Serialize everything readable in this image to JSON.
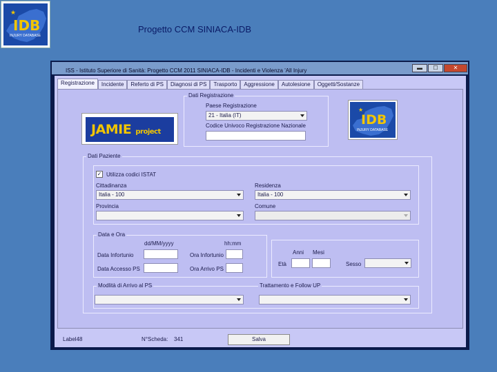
{
  "slide": {
    "title": "Progetto CCM SINIACA-IDB",
    "logo": {
      "main": "IDB",
      "tag": "INJURY DATABASE"
    }
  },
  "window": {
    "title": "ISS - Istituto Superiore di Sanità: Progetto CCM 2011 SINIACA-IDB - Incidenti e Violenza 'All Injury",
    "buttons": {
      "minimize": "▬",
      "maximize": "☐",
      "close": "✕"
    }
  },
  "tabs": [
    {
      "label": "Registrazione"
    },
    {
      "label": "Incidente"
    },
    {
      "label": "Referto di PS"
    },
    {
      "label": "Diagnosi di PS"
    },
    {
      "label": "Trasporto"
    },
    {
      "label": "Aggressione"
    },
    {
      "label": "Autolesione"
    },
    {
      "label": "Oggetti/Sostanze"
    }
  ],
  "logos": {
    "jamie": {
      "main": "JAMIE",
      "sub": "project"
    },
    "idb": {
      "main": "IDB",
      "tag": "INJURY DATABASE"
    }
  },
  "dati_registrazione": {
    "title": "Dati Registrazione",
    "paese_label": "Paese Registrazione",
    "paese_value": "21 - Italia (IT)",
    "codice_label": "Codice Univoco Registrazione Nazionale",
    "codice_value": ""
  },
  "dati_paziente": {
    "title": "Dati Paziente",
    "istat_label": "Utilizza codici ISTAT",
    "istat_checked": "✓",
    "cittadinanza_label": "Cittadinanza",
    "cittadinanza_value": "Italia - 100",
    "residenza_label": "Residenza",
    "residenza_value": "Italia - 100",
    "provincia_label": "Provincia",
    "provincia_value": "",
    "comune_label": "Comune",
    "comune_value": "",
    "data_ora": {
      "title": "Data e Ora",
      "date_hint": "dd/MM/yyyy",
      "time_hint": "hh:mm",
      "data_infortunio_label": "Data Infortunio",
      "ora_infortunio_label": "Ora Infortunio",
      "data_accesso_label": "Data Accesso PS",
      "ora_arrivo_label": "Ora Arrivo PS"
    },
    "eta": {
      "anni_label": "Anni",
      "mesi_label": "Mesi",
      "eta_label": "Età",
      "sesso_label": "Sesso",
      "sesso_value": ""
    },
    "modalita_label": "Modlità di Arrivo al PS",
    "modalita_value": "",
    "trattamento_label": "Trattamento e Follow UP",
    "trattamento_value": ""
  },
  "statusbar": {
    "label": "Label48",
    "scheda_label": "N°Scheda:",
    "scheda_value": "341",
    "salva_label": "Salva"
  }
}
